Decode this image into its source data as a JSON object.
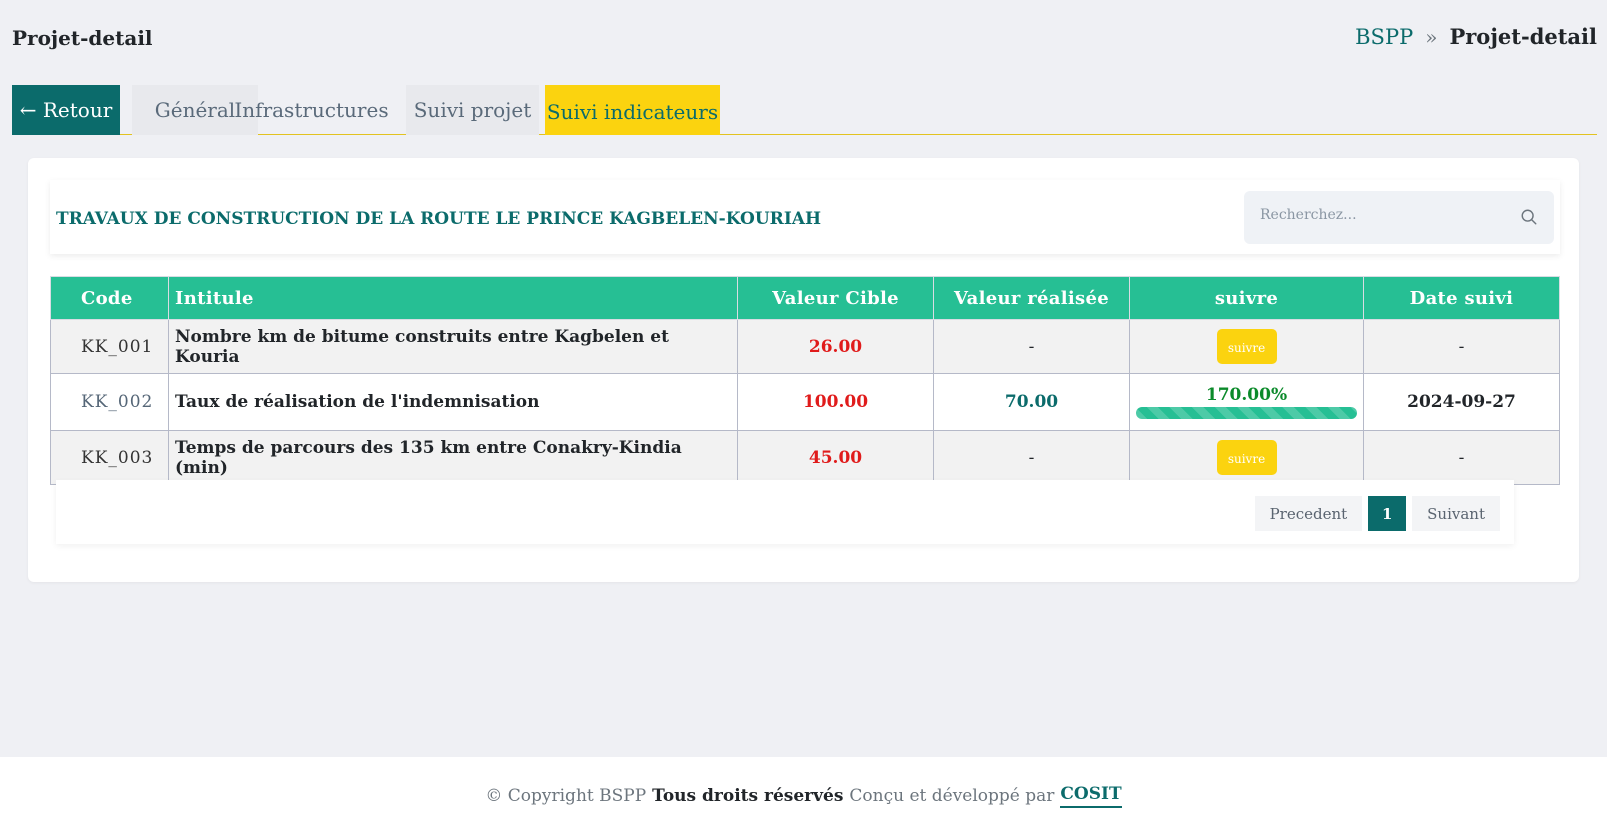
{
  "header": {
    "page_title": "Projet-detail",
    "breadcrumb": {
      "root": "BSPP",
      "separator": "»",
      "current": "Projet-detail"
    }
  },
  "tabs": {
    "back": "← Retour",
    "general": "Général",
    "infrastructures": "Infrastructures",
    "suivi_projet": "Suivi projet",
    "suivi_indicateurs": "Suivi indicateurs"
  },
  "project": {
    "title": "TRAVAUX DE CONSTRUCTION DE LA ROUTE LE PRINCE KAGBELEN-KOURIAH"
  },
  "search": {
    "placeholder": "Recherchez...",
    "value": ""
  },
  "table": {
    "columns": [
      "Code",
      "Intitule",
      "Valeur Cible",
      "Valeur réalisée",
      "suivre",
      "Date suivi"
    ],
    "rows": [
      {
        "code": "KK_001",
        "intitule": "Nombre km de bitume construits entre Kagbelen et Kouria",
        "valeur_cible": "26.00",
        "valeur_realisee": "-",
        "suivre_label": "suivre",
        "date_suivi": "-"
      },
      {
        "code": "KK_002",
        "intitule": "Taux de réalisation de l'indemnisation",
        "valeur_cible": "100.00",
        "valeur_realisee": "70.00",
        "progress_label": "170.00%",
        "progress_fill": 1.0,
        "date_suivi": "2024-09-27"
      },
      {
        "code": "KK_003",
        "intitule": "Temps de parcours des 135 km entre Conakry-Kindia (min)",
        "valeur_cible": "45.00",
        "valeur_realisee": "-",
        "suivre_label": "suivre",
        "date_suivi": "-"
      }
    ]
  },
  "pagination": {
    "prev": "Precedent",
    "current": "1",
    "next": "Suivant"
  },
  "footer": {
    "copyright": "© Copyright BSPP",
    "rights": "Tous droits réservés",
    "designed_by": "Conçu et développé par",
    "brand": "COSIT"
  },
  "colors": {
    "primary": "#0b6b6b",
    "accent": "#fbd30f",
    "table_header": "#26bf94",
    "target_value": "#e01b1b"
  }
}
